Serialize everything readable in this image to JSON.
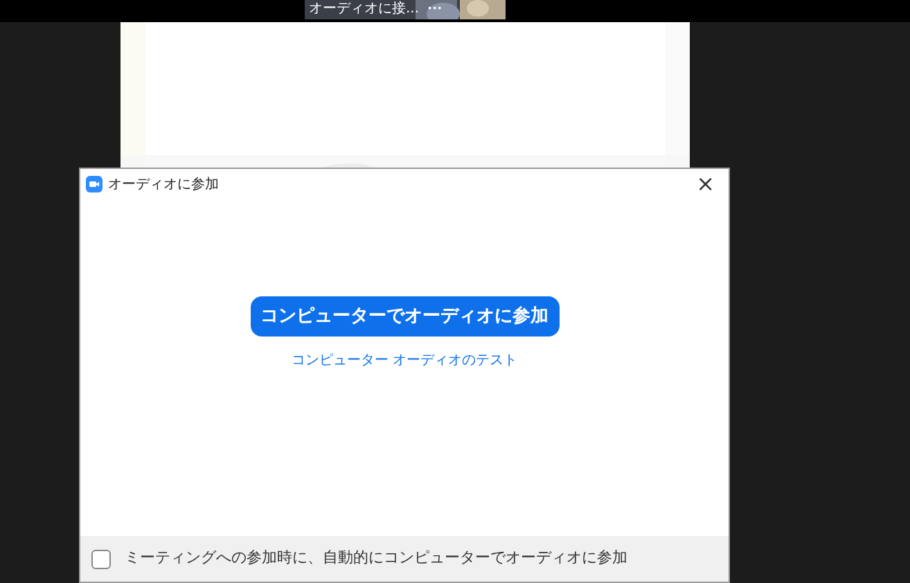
{
  "thumbnail": {
    "label": "オーディオに接...",
    "menu": "•••"
  },
  "dialog": {
    "title": "オーディオに参加",
    "close": "×",
    "join_button": "コンピューターでオーディオに参加",
    "test_link": "コンピューター オーディオのテスト",
    "auto_join": {
      "label": "ミーティングへの参加時に、自動的にコンピューターでオーディオに参加",
      "checked": false
    }
  }
}
